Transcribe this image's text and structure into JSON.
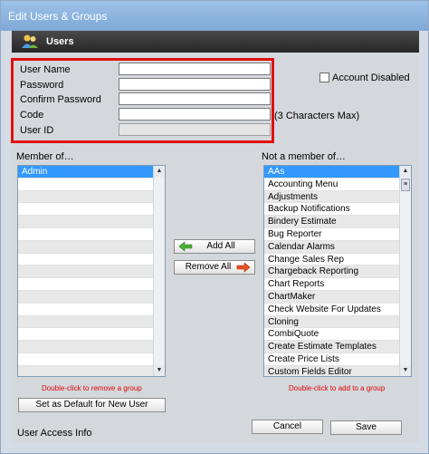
{
  "window": {
    "title": "Edit Users & Groups",
    "section_title": "Users",
    "section_icon": "users-icon"
  },
  "form": {
    "user_name_label": "User Name",
    "password_label": "Password",
    "confirm_password_label": "Confirm Password",
    "code_label": "Code",
    "user_id_label": "User ID",
    "code_hint": "(3 Characters Max)",
    "account_disabled_label": "Account Disabled",
    "user_name_value": "",
    "password_value": "",
    "confirm_password_value": "",
    "code_value": "",
    "user_id_value": ""
  },
  "member_of": {
    "label": "Member of…",
    "items": [
      "Admin"
    ],
    "hint": "Double-click to remove a group"
  },
  "not_member_of": {
    "label": "Not a member of…",
    "items": [
      "AAs",
      "Accounting Menu",
      "Adjustments",
      "Backup Notifications",
      "Bindery Estimate",
      "Bug Reporter",
      "Calendar Alarms",
      "Change Sales Rep",
      "Chargeback Reporting",
      "Chart Reports",
      "ChartMaker",
      "Check Website For Updates",
      "Cloning",
      "CombiQuote",
      "Create Estimate Templates",
      "Create Price Lists",
      "Custom Fields Editor"
    ],
    "hint": "Double-click to add to a group"
  },
  "buttons": {
    "add_all": "Add All",
    "remove_all": "Remove All",
    "set_default": "Set as Default for New User",
    "cancel": "Cancel",
    "save": "Save"
  },
  "footer": {
    "user_access_info": "User Access Info"
  },
  "colors": {
    "highlight_border": "#e01010",
    "selection": "#3399ff",
    "hint_text": "#e00000"
  }
}
